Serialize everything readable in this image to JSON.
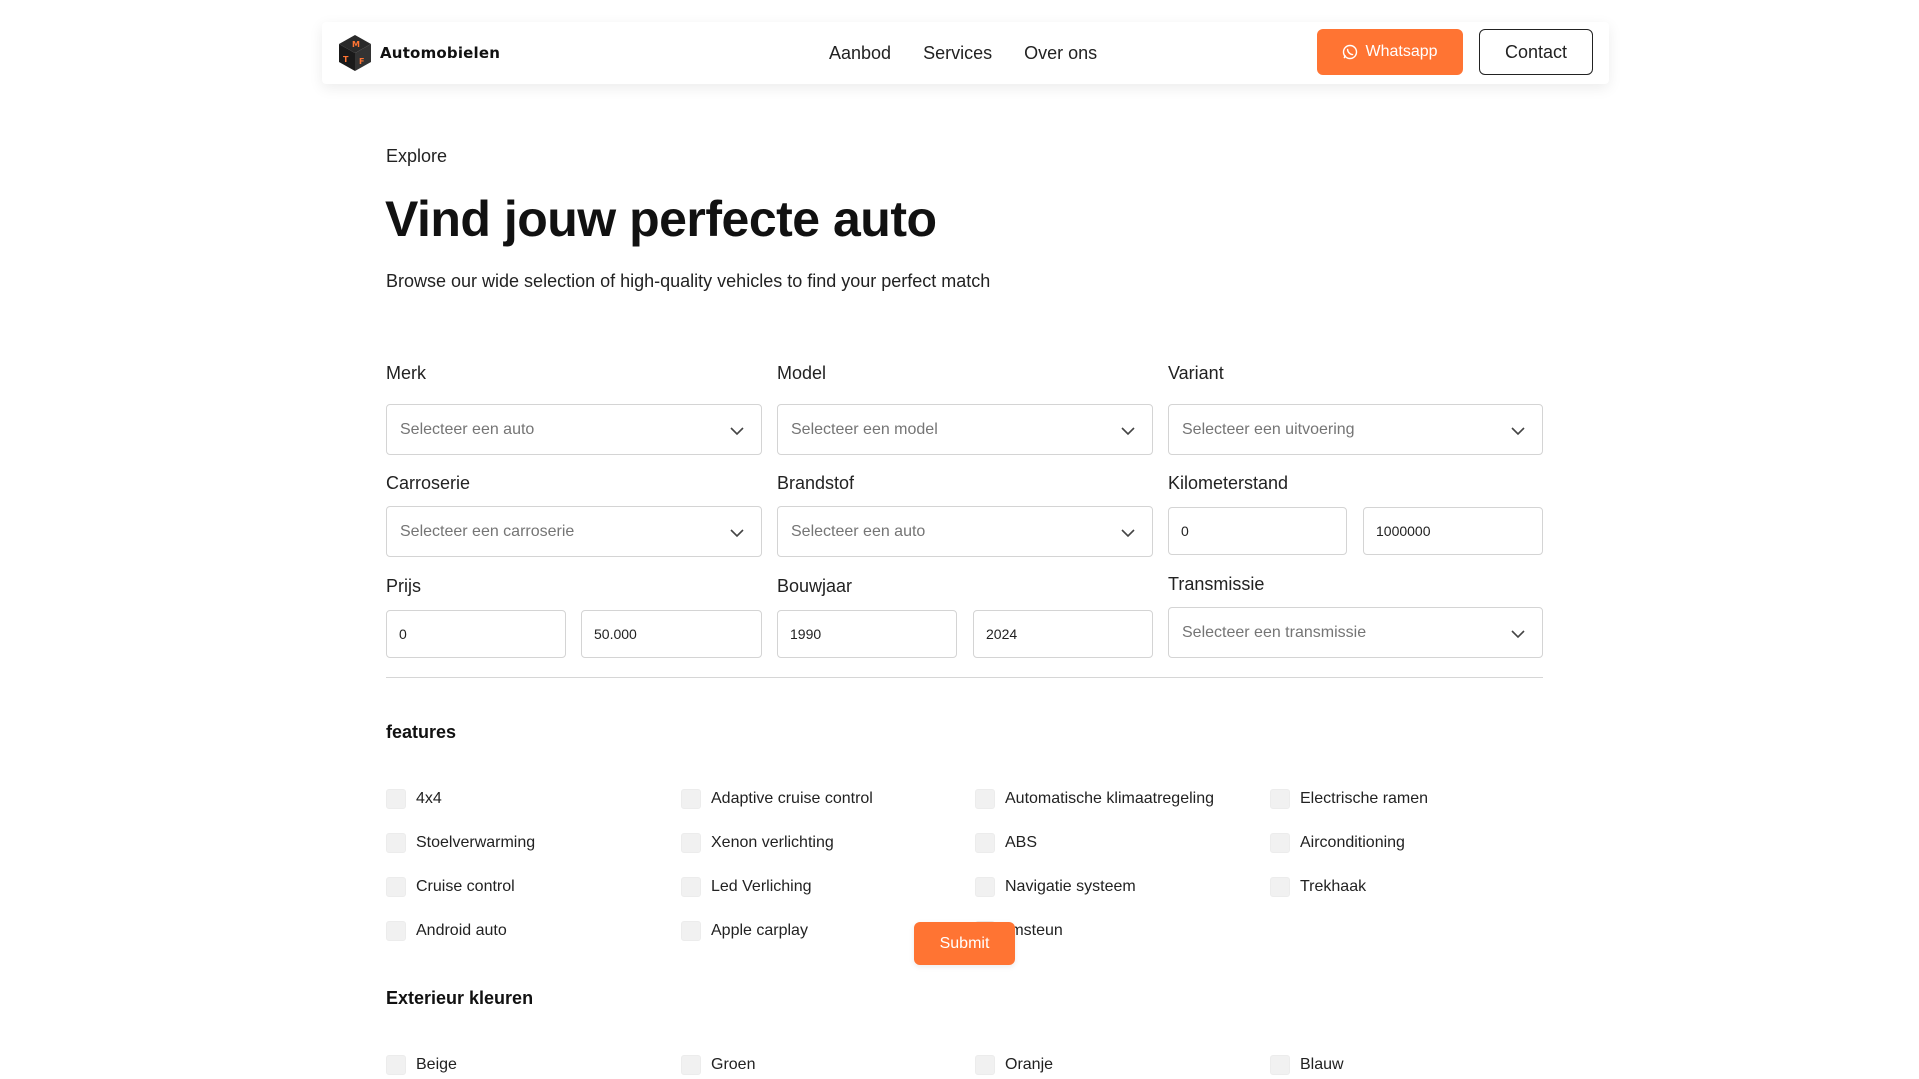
{
  "brand": {
    "name": "Automobielen"
  },
  "nav": {
    "links": [
      "Aanbod",
      "Services",
      "Over ons"
    ],
    "whatsapp_label": "Whatsapp",
    "contact_label": "Contact"
  },
  "hero": {
    "eyebrow": "Explore",
    "title": "Vind jouw perfecte auto",
    "subtitle": "Browse our wide selection of high-quality vehicles to find your perfect match"
  },
  "filters": {
    "merk": {
      "label": "Merk",
      "placeholder": "Selecteer een auto"
    },
    "model": {
      "label": "Model",
      "placeholder": "Selecteer een model"
    },
    "variant": {
      "label": "Variant",
      "placeholder": "Selecteer een uitvoering"
    },
    "carroserie": {
      "label": "Carroserie",
      "placeholder": "Selecteer een carroserie"
    },
    "brandstof": {
      "label": "Brandstof",
      "placeholder": "Selecteer een auto"
    },
    "kilometerstand": {
      "label": "Kilometerstand",
      "min": "0",
      "max": "1000000"
    },
    "prijs": {
      "label": "Prijs",
      "min": "0",
      "max": "50.000"
    },
    "bouwjaar": {
      "label": "Bouwjaar",
      "min": "1990",
      "max": "2024"
    },
    "transmissie": {
      "label": "Transmissie",
      "placeholder": "Selecteer een transmissie"
    }
  },
  "features": {
    "title": "features",
    "items": [
      "4x4",
      "Adaptive cruise control",
      "Automatische klimaatregeling",
      "Electrische ramen",
      "Stoelverwarming",
      "Xenon verlichting",
      "ABS",
      "Airconditioning",
      "Cruise control",
      "Led Verliching",
      "Navigatie systeem",
      "Trekhaak",
      "Android auto",
      "Apple carplay",
      "rmsteun"
    ]
  },
  "submit_label": "Submit",
  "exterieur": {
    "title": "Exterieur kleuren",
    "items": [
      "Beige",
      "Groen",
      "Oranje",
      "Blauw"
    ]
  },
  "colors": {
    "accent": "#ff7433",
    "text": "#222222",
    "border": "#d4d4d4",
    "checkbox": "#f1f1f1"
  }
}
